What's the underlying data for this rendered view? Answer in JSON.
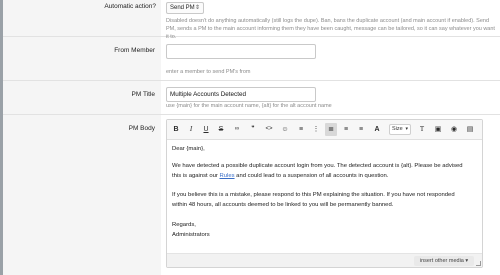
{
  "automatic_action": {
    "label": "Automatic action?",
    "selected": "Send PM",
    "description": "Disabled doesn't do anything automatically (still logs the dupe). Ban, bans the duplicate account (and main account if enabled). Send PM, sends a PM to the main account informing them they have been caught, message can be tailored, so it can say whatever you want it to."
  },
  "from_member": {
    "label": "From Member",
    "value": "",
    "placeholder": "",
    "description": "enter a member to send PM's from"
  },
  "pm_title": {
    "label": "PM Title",
    "value": "Multiple Accounts Detected",
    "description": "use {main} for the main account name, {alt} for the alt account name"
  },
  "pm_body": {
    "label": "PM Body",
    "toolbar": {
      "bold": "B",
      "italic": "I",
      "underline": "U",
      "strike": "S",
      "link": "🔗",
      "unlink": "⊘",
      "code": "<>",
      "emoji": "☺",
      "bullets": "≡",
      "numbered": "⋮",
      "align_left": "≣",
      "align_center": "≡",
      "align_right": "≡",
      "font": "A",
      "size": "Size",
      "clear": "T",
      "image": "▣",
      "preview": "◉",
      "source": "▤"
    },
    "lines": {
      "greeting": "Dear {main},",
      "para1_a": "We have detected a possible duplicate account login from you. The detected account is {alt}. Please be advised",
      "para1_b_pre": "this is against our ",
      "rules_link": "Rules",
      "para1_b_post": " and could lead to a suspension of all accounts in question.",
      "para2_a": "If you believe this is a mistake, please respond to this PM explaining the situation. If you have not responded",
      "para2_b": "within 48 hours, all accounts deemed to be linked to you will be permanently banned.",
      "sign1": "Regards,",
      "sign2": "Administrators"
    },
    "insert_media": "insert other media ▾"
  }
}
